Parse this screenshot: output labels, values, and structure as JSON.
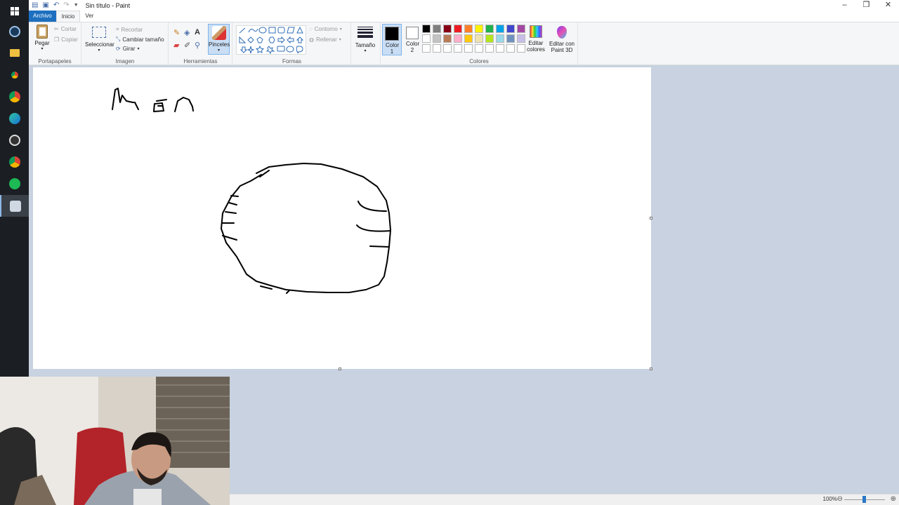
{
  "window": {
    "title": "Sin título - Paint"
  },
  "tabs": [
    {
      "label": "Archivo"
    },
    {
      "label": "Inicio"
    },
    {
      "label": "Ver"
    }
  ],
  "ribbon": {
    "clipboard": {
      "label": "Portapapeles",
      "paste": "Pegar",
      "cut": "Cortar",
      "copy": "Copiar"
    },
    "image": {
      "label": "Imagen",
      "select": "Seleccionar",
      "crop": "Recortar",
      "resize": "Cambiar tamaño",
      "rotate": "Girar"
    },
    "tools": {
      "label": "Herramientas",
      "brushes": "Pinceles"
    },
    "shapes": {
      "label": "Formas",
      "outline": "Contorno",
      "fill": "Rellenar"
    },
    "size": {
      "label": "Tamaño"
    },
    "colors": {
      "label": "Colores",
      "color1": "Color 1",
      "color2": "Color 2",
      "edit": "Editar colores",
      "color1_value": "#000000",
      "color2_value": "#ffffff",
      "palette_row1": [
        "#000000",
        "#7f7f7f",
        "#880015",
        "#ed1c24",
        "#ff7f27",
        "#fff200",
        "#22b14c",
        "#00a2e8",
        "#3f48cc",
        "#a349a4"
      ],
      "palette_row2": [
        "#ffffff",
        "#c3c3c3",
        "#b97a57",
        "#ffaec9",
        "#ffc90e",
        "#efe4b0",
        "#b5e61d",
        "#99d9ea",
        "#7092be",
        "#c8bfe7"
      ]
    },
    "paint3d": {
      "label": "Editar con Paint 3D"
    }
  },
  "status": {
    "zoom": "100%"
  },
  "taskbar": {
    "icons": [
      "windows-start-icon",
      "steam-icon",
      "file-explorer-icon",
      "chrome-icon",
      "chrome-icon",
      "edge-icon",
      "obs-icon",
      "chrome-icon",
      "spotify-icon",
      "paint-icon"
    ]
  }
}
